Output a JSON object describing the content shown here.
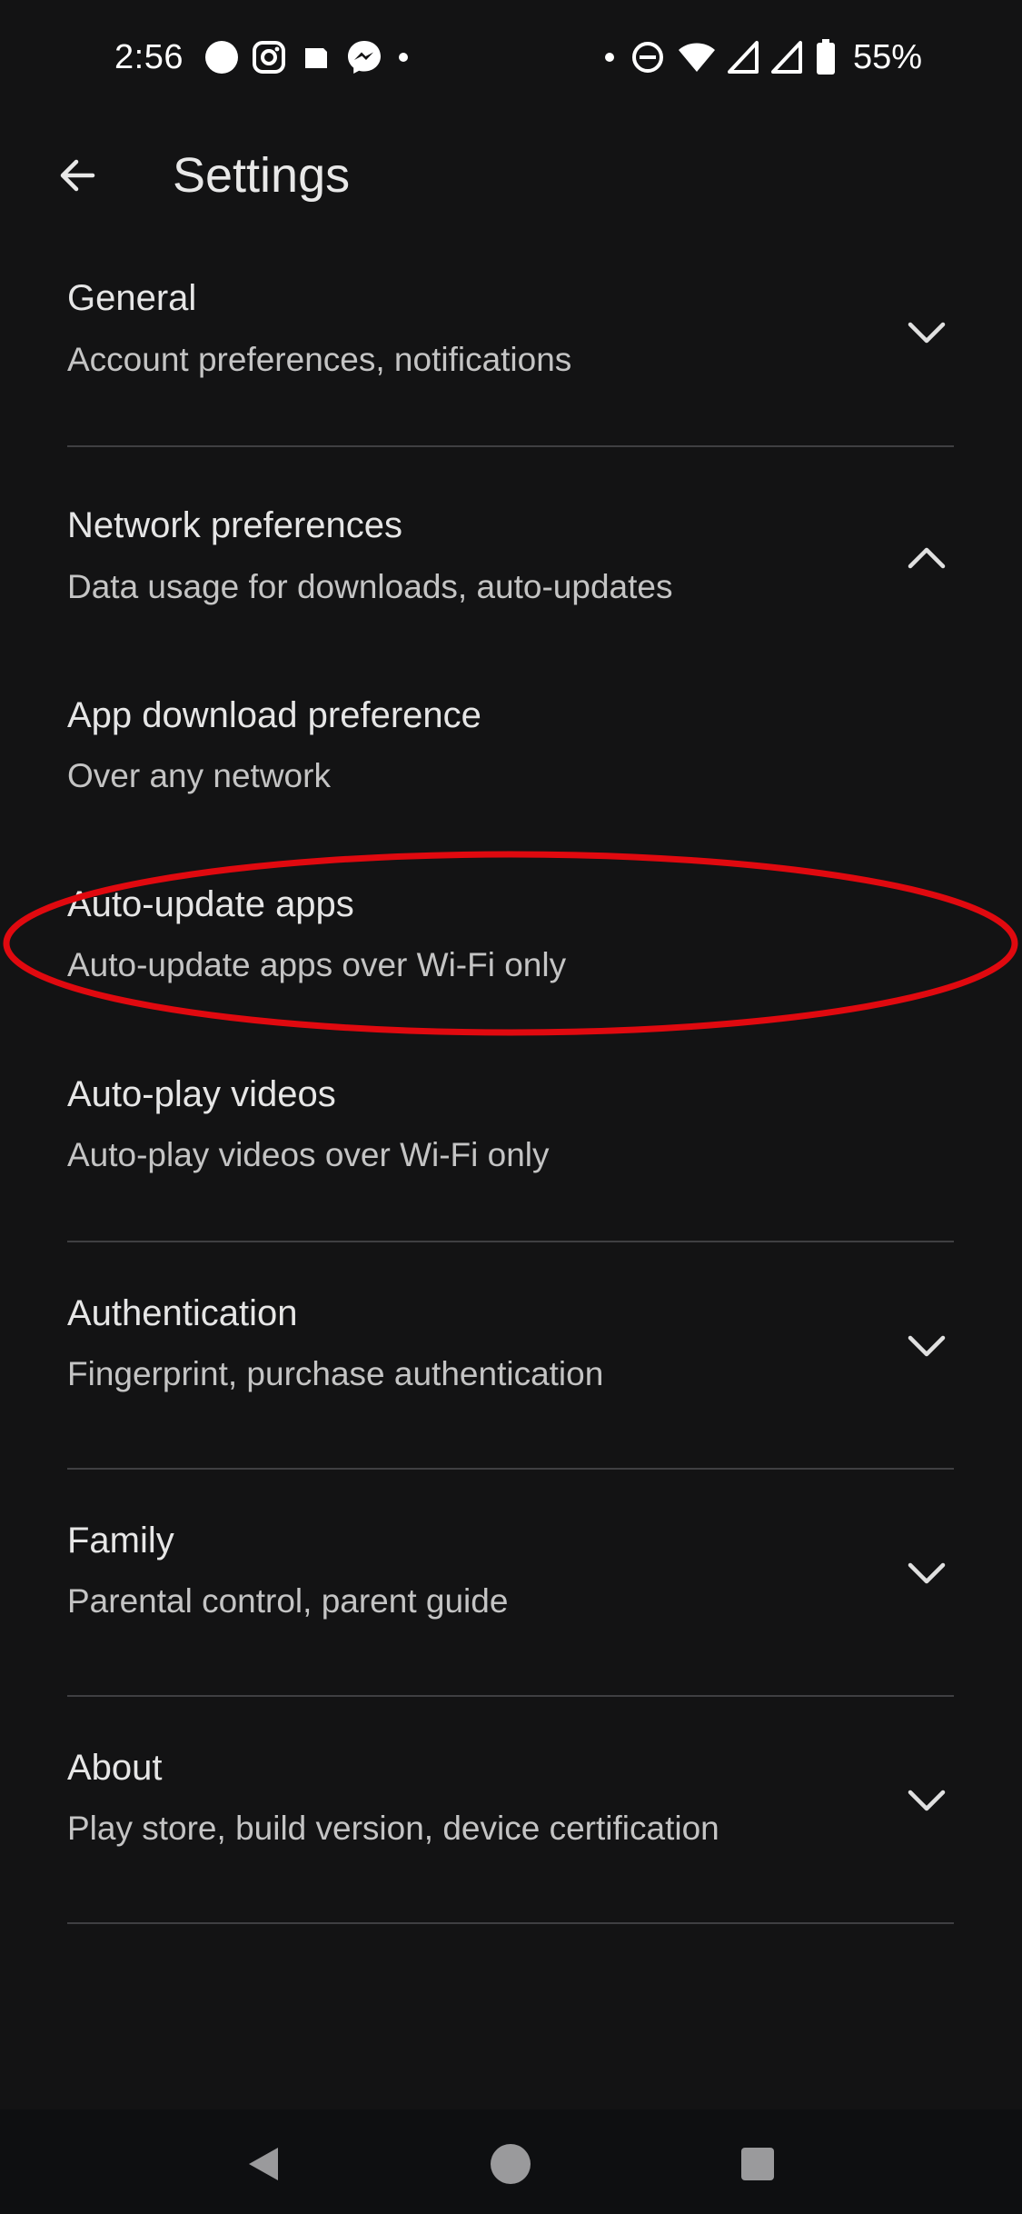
{
  "status_bar": {
    "time": "2:56",
    "battery_percent": "55%",
    "left_icons": [
      "circle-notification-icon",
      "instagram-icon",
      "square-notification-icon",
      "messenger-icon",
      "dot-icon"
    ],
    "right_icons": [
      "dot-icon",
      "do-not-disturb-icon",
      "wifi-icon",
      "signal-icon",
      "signal-icon",
      "battery-icon"
    ]
  },
  "app_bar": {
    "back_icon": "arrow-left-icon",
    "title": "Settings"
  },
  "settings": {
    "general": {
      "title": "General",
      "subtitle": "Account preferences, notifications",
      "expanded": false
    },
    "network": {
      "title": "Network preferences",
      "subtitle": "Data usage for downloads, auto-updates",
      "expanded": true,
      "items": [
        {
          "title": "App download preference",
          "subtitle": "Over any network"
        },
        {
          "title": "Auto-update apps",
          "subtitle": "Auto-update apps over Wi-Fi only"
        },
        {
          "title": "Auto-play videos",
          "subtitle": "Auto-play videos over Wi-Fi only"
        }
      ]
    },
    "authentication": {
      "title": "Authentication",
      "subtitle": "Fingerprint, purchase authentication",
      "expanded": false
    },
    "family": {
      "title": "Family",
      "subtitle": "Parental control, parent guide",
      "expanded": false
    },
    "about": {
      "title": "About",
      "subtitle": "Play store, build version, device certification",
      "expanded": false
    }
  },
  "highlight": {
    "target": "Auto-update apps",
    "color": "#e0090f"
  },
  "colors": {
    "background": "#131314",
    "text_primary": "#e6e6e6",
    "text_secondary": "#c4c4c4",
    "divider": "#3f3f42"
  },
  "nav_bar": {
    "icons": [
      "nav-back-icon",
      "nav-home-icon",
      "nav-recents-icon"
    ]
  }
}
